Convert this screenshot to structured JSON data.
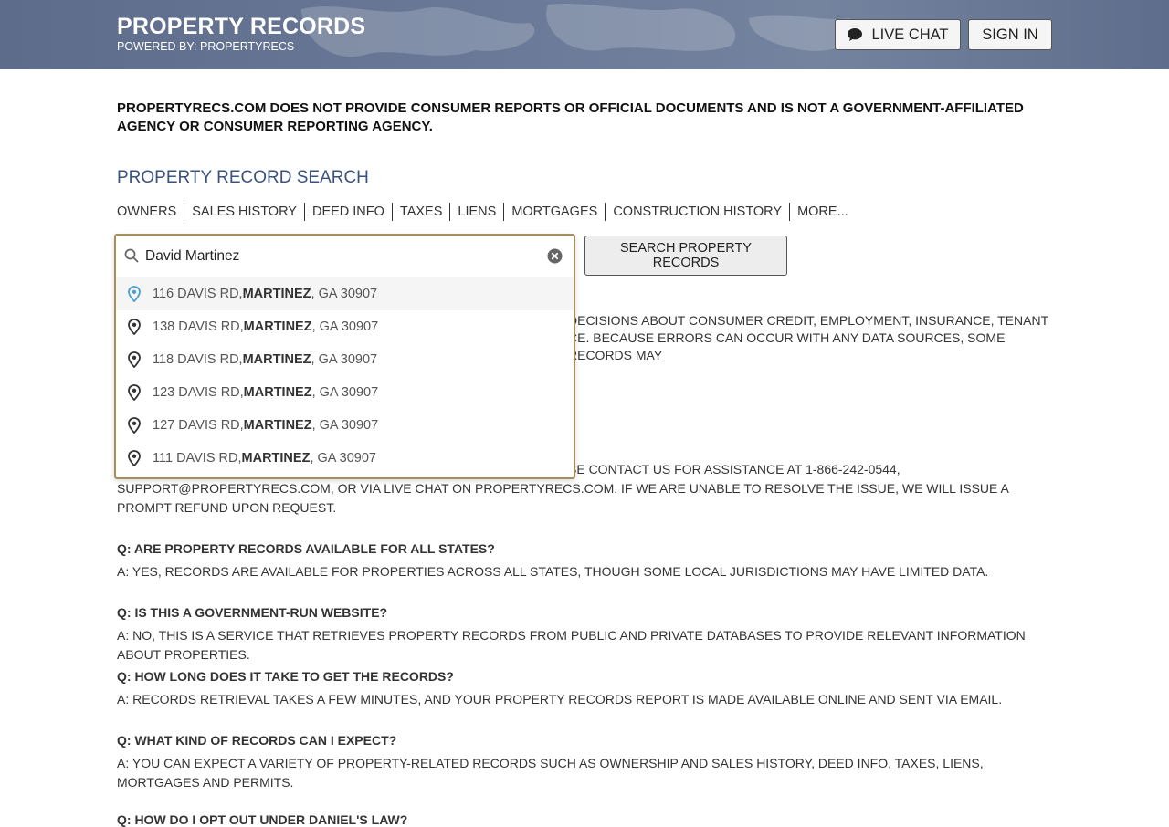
{
  "header": {
    "title": "PROPERTY RECORDS",
    "subtitle": "POWERED BY: PROPERTYRECS",
    "live_chat": "LIVE CHAT",
    "sign_in": "SIGN IN"
  },
  "disclaimer": "PROPERTYRECS.COM DOES NOT PROVIDE CONSUMER REPORTS OR OFFICIAL DOCUMENTS AND IS NOT A GOVERNMENT-AFFILIATED AGENCY OR CONSUMER REPORTING AGENCY.",
  "search": {
    "title": "PROPERTY RECORD SEARCH",
    "tabs": [
      "OWNERS",
      "SALES HISTORY",
      "DEED INFO",
      "TAXES",
      "LIENS",
      "MORTGAGES",
      "CONSTRUCTION HISTORY",
      "MORE..."
    ],
    "value": "David Martinez",
    "button": "SEARCH PROPERTY RECORDS",
    "suggestions": [
      {
        "street": "116 DAVIS RD, ",
        "city": "MARTINEZ",
        "rest": ", GA 30907"
      },
      {
        "street": "138 DAVIS RD, ",
        "city": "MARTINEZ",
        "rest": ", GA 30907"
      },
      {
        "street": "118 DAVIS RD, ",
        "city": "MARTINEZ",
        "rest": ", GA 30907"
      },
      {
        "street": "123 DAVIS RD, ",
        "city": "MARTINEZ",
        "rest": ", GA 30907"
      },
      {
        "street": "127 DAVIS RD, ",
        "city": "MARTINEZ",
        "rest": ", GA 30907"
      },
      {
        "street": "111 DAVIS RD, ",
        "city": "MARTINEZ",
        "rest": ", GA 30907"
      }
    ]
  },
  "hidden_text": {
    "line1": "DECISIONS ABOUT CONSUMER CREDIT, EMPLOYMENT, INSURANCE, TENANT",
    "line2": "CE. BECAUSE ERRORS CAN OCCUR WITH ANY DATA SOURCES, SOME RECORDS MAY",
    "contact_line": "SE CONTACT US FOR ASSISTANCE AT 1-866-242-0544,",
    "contact_rest": "SUPPORT@PROPERTYRECS.COM, OR VIA LIVE CHAT ON PROPERTYRECS.COM. IF WE ARE UNABLE TO RESOLVE THE ISSUE, WE WILL ISSUE A PROMPT REFUND UPON REQUEST."
  },
  "faq": [
    {
      "q": "Q: ARE PROPERTY RECORDS AVAILABLE FOR ALL STATES?",
      "a": "A: YES, RECORDS ARE AVAILABLE FOR PROPERTIES ACROSS ALL STATES, THOUGH SOME LOCAL JURISDICTIONS MAY HAVE LIMITED DATA."
    },
    {
      "q": "Q: IS THIS A GOVERNMENT-RUN WEBSITE?",
      "a": "A: NO, THIS IS A SERVICE THAT RETRIEVES PROPERTY RECORDS FROM PUBLIC AND PRIVATE DATABASES TO PROVIDE RELEVANT INFORMATION ABOUT PROPERTIES."
    },
    {
      "q": "Q: HOW LONG DOES IT TAKE TO GET THE RECORDS?",
      "a": "A: RECORDS RETRIEVAL TAKES A FEW MINUTES, AND YOUR PROPERTY RECORDS REPORT IS MADE AVAILABLE ONLINE AND SENT VIA EMAIL."
    },
    {
      "q": "Q: WHAT KIND OF RECORDS CAN I EXPECT?",
      "a": "A: YOU CAN EXPECT A VARIETY OF PROPERTY-RELATED RECORDS SUCH AS OWNERSHIP AND SALES HISTORY, DEED INFO, TAXES, LIENS, MORTGAGES AND PERMITS."
    },
    {
      "q": "Q: HOW DO I OPT OUT UNDER DANIEL'S LAW?",
      "a": ""
    }
  ],
  "colors": {
    "header_bg": "#6a7a98",
    "accent_title": "#3a527e",
    "search_border": "#a88f5a",
    "active_pin": "#4a9fd4"
  },
  "icons": {
    "search": "search-icon",
    "clear": "clear-icon",
    "chat": "chat-bubble-icon",
    "pin": "map-pin-icon"
  }
}
